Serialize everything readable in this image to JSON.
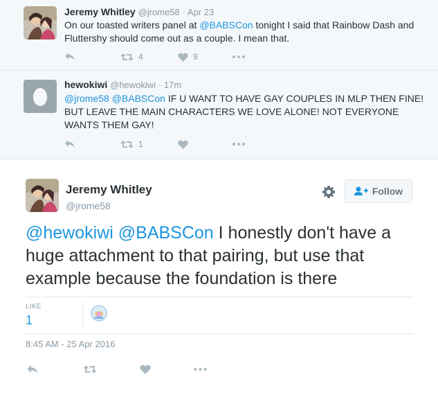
{
  "reply1": {
    "name": "Jeremy Whitley",
    "handle": "@jrome58",
    "time": "· Apr 23",
    "text_before": "On our toasted writers panel at ",
    "mention": "@BABSCon",
    "text_after": " tonight I said that Rainbow Dash and Fluttershy should come out as a couple. I mean that.",
    "retweets": "4",
    "likes": "9"
  },
  "reply2": {
    "name": "hewokiwi",
    "handle": "@hewokiwi",
    "time": "· 17m",
    "mention1": "@jrome58",
    "mention2": "@BABSCon",
    "text": " IF U WANT TO HAVE GAY COUPLES IN MLP THEN FINE! BUT LEAVE THE MAIN CHARACTERS WE LOVE ALONE! NOT EVERYONE WANTS THEM GAY!",
    "retweets": "1"
  },
  "main": {
    "name": "Jeremy Whitley",
    "handle": "@jrome58",
    "follow_label": "Follow",
    "mention1": "@hewokiwi",
    "mention2": "@BABSCon",
    "text": " I honestly don't have a huge attachment to that pairing,  but use that example because the foundation is there",
    "like_label": "LIKE",
    "like_count": "1",
    "timestamp": "8:45 AM - 25 Apr 2016"
  },
  "colors": {
    "link": "#1b95e0",
    "muted": "#8899a6",
    "icon": "#aab8c2",
    "reply_bg": "#f5f8fa"
  },
  "icons": [
    "reply-icon",
    "retweet-icon",
    "heart-icon",
    "more-icon",
    "gear-icon",
    "follow-user-icon"
  ]
}
